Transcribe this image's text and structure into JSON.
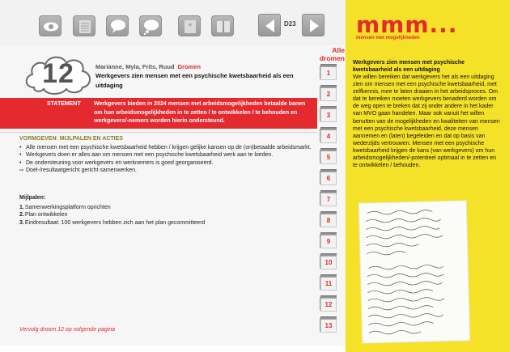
{
  "toolbar": {
    "buttons": [
      {
        "name": "eye-icon"
      },
      {
        "name": "list-icon"
      },
      {
        "name": "speech-bubble-icon"
      },
      {
        "name": "thought-bubble-icon"
      },
      {
        "name": "asterisk-icon"
      },
      {
        "name": "book-icon"
      }
    ],
    "page_code": "D23"
  },
  "header": {
    "number": "12",
    "names": "Marianne, Myla, Frits, Ruud",
    "dream_word": "Dromen",
    "title": "Werkgevers zien mensen met een psychische kwetsbaarheid als een uitdaging",
    "alle_dromen": "Alle dromen"
  },
  "statement": {
    "label": "STATEMENT",
    "text": "Werkgevers bieden in 2024 mensen met arbeidsmogelijkheden betaalde banen om hun arbeidsmogelijkheden in te zetten / te ontwikkelen / te behouden en werkgevers/-nemers worden hierin ondersteund."
  },
  "vormgeven": {
    "title": "VORMGEVEN: MIJLPALEN EN ACTIES",
    "bullets": [
      "Alle mensen met een psychische kwetsbaarheid hebben / krijgen gelijke kansen op de (on)betaalde arbeidsmarkt.",
      "Werkgevers doen er alles aan om mensen met een psychische kwetsbaarheid werk aan te bieden.",
      "De ondersteuning voor werkgevers en werknemers is goed georganiseerd.",
      "Doel-/resultaatgericht gericht samenwerken."
    ]
  },
  "mijlpalen": {
    "title": "Mijlpalen:",
    "items": [
      {
        "n": "1.",
        "text": "Samenwerkingsplatform oprichten"
      },
      {
        "n": "2.",
        "text": "Plan ontwikkelen"
      },
      {
        "n": "3.",
        "text": "Eindresultaat: 100 werkgevers hebben zich aan het plan gecommitteerd"
      }
    ]
  },
  "vervolg": "Vervolg droom 12 op volgende pagina",
  "tabs": [
    "1",
    "2",
    "3",
    "4",
    "5",
    "6",
    "7",
    "8",
    "9",
    "10",
    "11",
    "12",
    "13"
  ],
  "sidebar": {
    "logo": "mmm...",
    "logo_sub": "mensen met mogelijkheden",
    "title": "Werkgevers zien mensen met psychische kwetsbaarheid als een uitdaging",
    "body": "We willen bereiken dat werkgevers het als een uitdaging zien om mensen met een psychische kwetsbaarheid, met zelfkennis, mee te laten draaien in het arbeidsproces. Om dat te bereiken moeten werkgevers benaderd worden om de weg open te breken dat zij onder andere in het kader van MVO gaan handelen. Maar ook vanuit het willen benutten van de mogelijkheden en kwaliteiten van mensen met een psychische kwetsbaarheid, deze mensen aannemen en (laten) begeleiden en dat op basis van wederzijds vertrouwen. Mensen met een psychische kwetsbaarheid krijgen de kans (van werkgevers) om hun arbeidsmogelijkheden/-potentieel optimaal in te zetten en te ontwikkelen / behouden."
  },
  "colors": {
    "accent_red": "#e42a2f",
    "panel_yellow": "#f5e228"
  }
}
